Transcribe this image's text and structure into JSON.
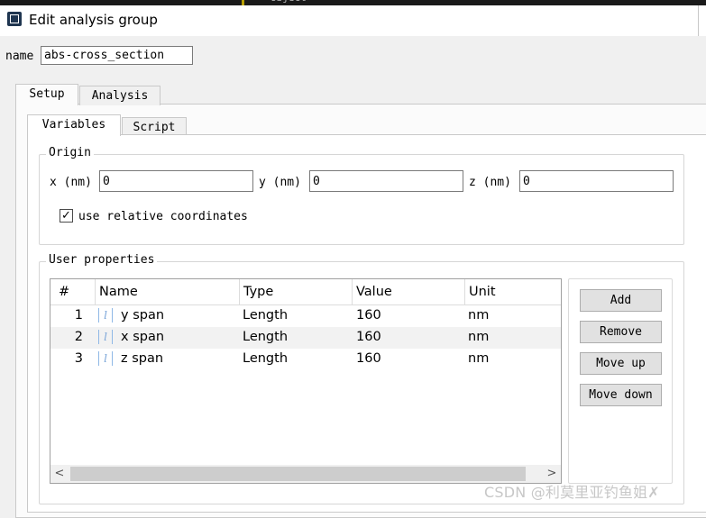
{
  "background_window": {
    "fragment_text": "object"
  },
  "window": {
    "title": "Edit analysis group"
  },
  "name_field": {
    "label": "name",
    "value": "abs-cross_section"
  },
  "outer_tabs": [
    {
      "label": "Setup",
      "active": true
    },
    {
      "label": "Analysis",
      "active": false
    }
  ],
  "inner_tabs": [
    {
      "label": "Variables",
      "active": true
    },
    {
      "label": "Script",
      "active": false
    }
  ],
  "origin": {
    "group_label": "Origin",
    "x": {
      "label": "x (nm)",
      "value": "0"
    },
    "y": {
      "label": "y (nm)",
      "value": "0"
    },
    "z": {
      "label": "z (nm)",
      "value": "0"
    },
    "relative": {
      "label": "use relative coordinates",
      "checked": true,
      "check_glyph": "✓"
    }
  },
  "user_properties": {
    "group_label": "User properties",
    "columns": [
      "#",
      "Name",
      "Type",
      "Value",
      "Unit"
    ],
    "sort_glyph": "^",
    "var_icon_glyph": "l",
    "rows": [
      {
        "num": "1",
        "name": "y span",
        "type": "Length",
        "value": "160",
        "unit": "nm"
      },
      {
        "num": "2",
        "name": "x span",
        "type": "Length",
        "value": "160",
        "unit": "nm"
      },
      {
        "num": "3",
        "name": "z span",
        "type": "Length",
        "value": "160",
        "unit": "nm"
      }
    ],
    "scroll_left_glyph": "<",
    "scroll_right_glyph": ">"
  },
  "buttons": {
    "add": "Add",
    "remove": "Remove",
    "move_up": "Move up",
    "move_down": "Move down"
  },
  "watermark": "CSDN @利莫里亚钓鱼姐✗",
  "colors": {
    "window_bg": "#f0f0f0",
    "title_bar": "#ffffff",
    "icon_accent": "#1f3550",
    "alt_row": "#f2f2f2",
    "var_icon": "#7aa5d8"
  }
}
